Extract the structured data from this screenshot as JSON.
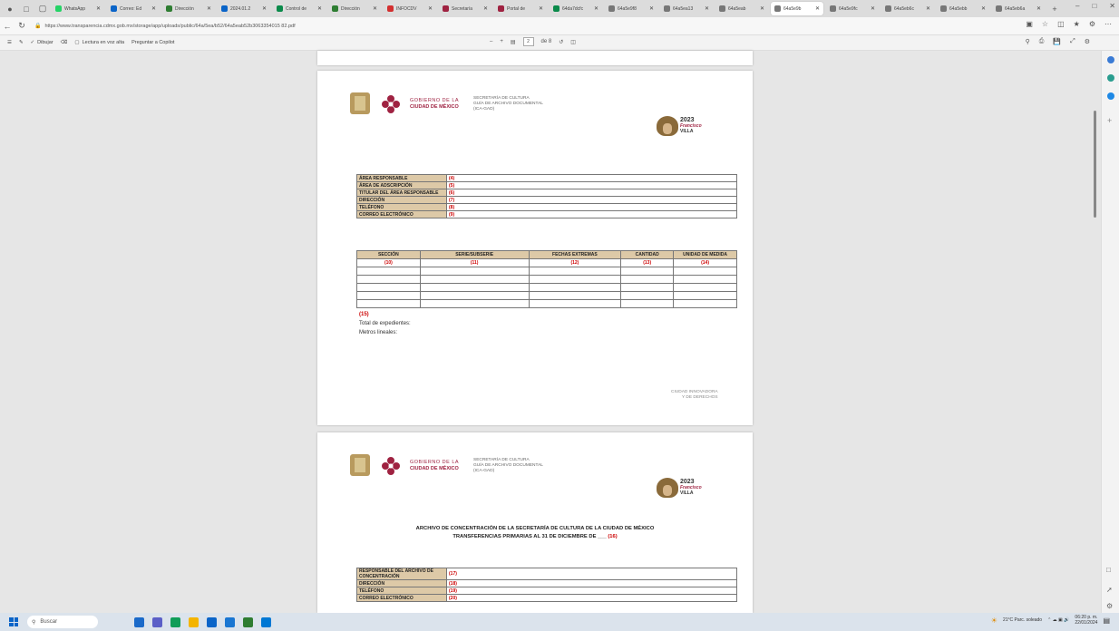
{
  "browser": {
    "tabs": [
      {
        "label": "WhatsApp",
        "color": "#25d366"
      },
      {
        "label": "Correo: Ed",
        "color": "#0a64c8"
      },
      {
        "label": "Dirección",
        "color": "#2e7d32"
      },
      {
        "label": "2024.01.2",
        "color": "#0a64c8"
      },
      {
        "label": "Control de",
        "color": "#0a8a4a"
      },
      {
        "label": "Dirección",
        "color": "#2e7d32"
      },
      {
        "label": "INFOCDV",
        "color": "#d32f2f"
      },
      {
        "label": "Secretaría",
        "color": "#9f2241"
      },
      {
        "label": "Portal de",
        "color": "#9f2241"
      },
      {
        "label": "64da7dcfc",
        "color": "#0a8a4a"
      },
      {
        "label": "64a5e9f8",
        "color": "#777777"
      },
      {
        "label": "64a5ea13",
        "color": "#777777"
      },
      {
        "label": "64a5eab",
        "color": "#777777"
      },
      {
        "label": "64a5e9b",
        "color": "#777777"
      },
      {
        "label": "64a5e9fc",
        "color": "#777777"
      },
      {
        "label": "64a5eb6c",
        "color": "#777777"
      },
      {
        "label": "64a5ebb",
        "color": "#777777"
      },
      {
        "label": "64a5eb6a",
        "color": "#777777"
      }
    ],
    "url": "https://www.transparencia.cdmx.gob.mx/storage/app/uploads/public/64a/5ea/b52/64a5eab52b3063354015 82.pdf"
  },
  "pdf_toolbar": {
    "draw": "Dibujar",
    "read_aloud": "Lectura en voz alta",
    "copilot": "Preguntar a Copilot",
    "page_num": "2",
    "page_total": "de 8"
  },
  "page1": {
    "gov_line1": "GOBIERNO DE LA",
    "gov_line2": "CIUDAD DE MÉXICO",
    "sect_line1": "SECRETARÍA DE CULTURA",
    "sect_line2": "GUÍA DE ARCHIVO DOCUMENTAL",
    "sect_line3": "(ICA-GAD)",
    "year": "2023",
    "year_sub1": "Francisco",
    "year_sub2": "VILLA",
    "info_rows": [
      {
        "label": "ÁREA RESPONSABLE",
        "value": "(4)"
      },
      {
        "label": "ÁREA DE ADSCRIPCIÓN",
        "value": "(5)"
      },
      {
        "label": "TITULAR DEL ÁREA RESPONSABLE",
        "value": "(6)"
      },
      {
        "label": "DIRECCIÓN",
        "value": "(7)"
      },
      {
        "label": "TELÉFONO",
        "value": "(8)"
      },
      {
        "label": "CORREO ELECTRÓNICO",
        "value": "(9)"
      }
    ],
    "columns": [
      "SECCIÓN",
      "SERIE/SUBSERIE",
      "FECHAS EXTREMAS",
      "CANTIDAD",
      "UNIDAD DE MEDIDA"
    ],
    "col_codes": [
      "(10)",
      "(11)",
      "(12)",
      "(13)",
      "(14)"
    ],
    "note_code": "(15)",
    "total_exp": "Total de expedientes:",
    "metros": "Metros lineales:",
    "footer1": "CIUDAD INNOVADORA",
    "footer2": "Y DE DERECHOS"
  },
  "page2": {
    "title_line1": "ARCHIVO DE CONCENTRACIÓN DE LA SECRETARÍA DE CULTURA DE LA CIUDAD DE MÉXICO",
    "title_line2": "TRANSFERENCIAS PRIMARIAS AL 31 DE DICIEMBRE DE ___",
    "title_code": "(16)",
    "info_rows": [
      {
        "label": "RESPONSABLE DEL ARCHIVO DE CONCENTRACIÓN",
        "value": "(17)"
      },
      {
        "label": "DIRECCIÓN",
        "value": "(18)"
      },
      {
        "label": "TELÉFONO",
        "value": "(19)"
      },
      {
        "label": "CORREO ELECTRÓNICO",
        "value": "(20)"
      }
    ]
  },
  "taskbar": {
    "search": "Buscar",
    "weather": "21°C Parc. soleado",
    "time": "06:20 p. m.",
    "date": "22/01/2024"
  }
}
